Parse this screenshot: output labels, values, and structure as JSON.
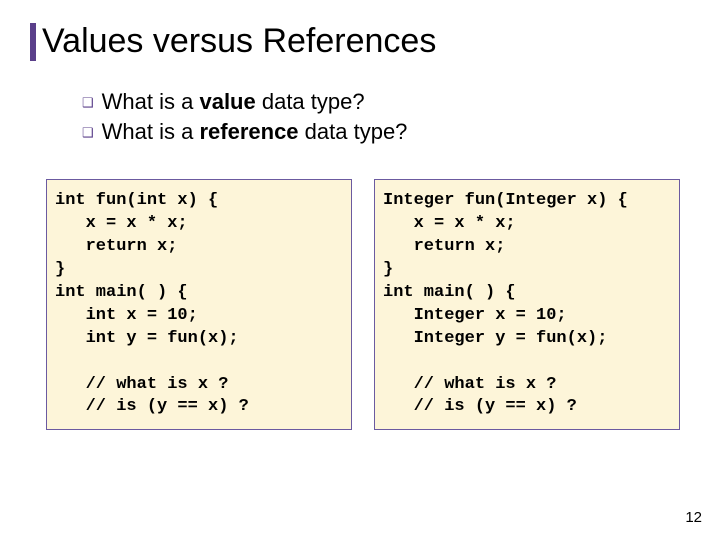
{
  "title": "Values versus References",
  "bullets": [
    {
      "prefix": "What is a ",
      "bold": "value",
      "suffix": " data type?"
    },
    {
      "prefix": "What is a ",
      "bold": "reference",
      "suffix": " data type?"
    }
  ],
  "code_left": "int fun(int x) {\n   x = x * x;\n   return x;\n}\nint main( ) {\n   int x = 10;\n   int y = fun(x);\n\n   // what is x ?\n   // is (y == x) ?",
  "code_right": "Integer fun(Integer x) {\n   x = x * x;\n   return x;\n}\nint main( ) {\n   Integer x = 10;\n   Integer y = fun(x);\n\n   // what is x ?\n   // is (y == x) ?",
  "page_number": "12"
}
